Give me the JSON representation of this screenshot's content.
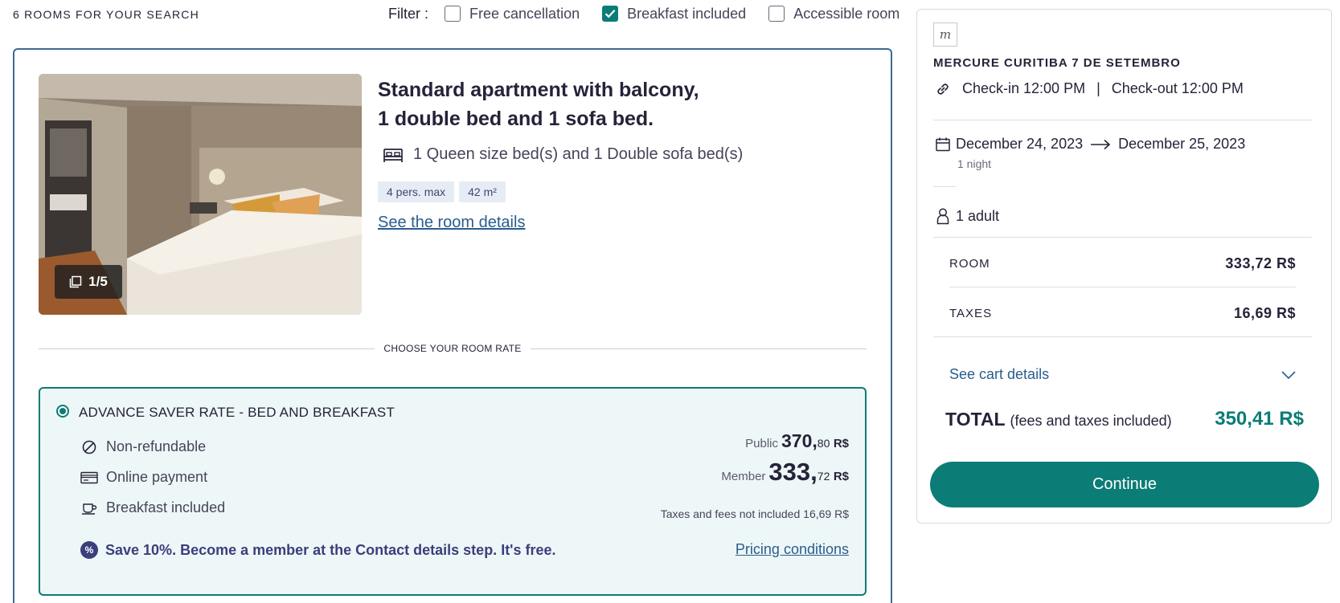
{
  "results": {
    "count_label": "6 ROOMS FOR YOUR SEARCH"
  },
  "filters": {
    "label": "Filter :",
    "options": [
      {
        "label": "Free cancellation",
        "checked": false
      },
      {
        "label": "Breakfast included",
        "checked": true
      },
      {
        "label": "Accessible room",
        "checked": false
      }
    ]
  },
  "room": {
    "title_line1": "Standard apartment with balcony,",
    "title_line2": "1 double bed and 1 sofa bed.",
    "beds": "1 Queen size bed(s) and 1 Double sofa bed(s)",
    "tags": [
      "4 pers. max",
      "42 m²"
    ],
    "details_link": "See the room details",
    "gallery_counter": "1/5",
    "choose_rate_label": "CHOOSE YOUR ROOM RATE"
  },
  "rate": {
    "name": "ADVANCE SAVER RATE - BED AND BREAKFAST",
    "selected": true,
    "features": [
      "Non-refundable",
      "Online payment",
      "Breakfast included"
    ],
    "promo": "Save 10%. Become a member at the Contact details step. It's free.",
    "public_label": "Public",
    "public_int": "370",
    "public_cents": "80",
    "member_label": "Member",
    "member_int": "333",
    "member_cents": "72",
    "separator": ",",
    "currency": "R$",
    "taxes_note_prefix": "Taxes and fees not included",
    "taxes_int": "16",
    "taxes_cents": "69",
    "pricing_link": "Pricing conditions"
  },
  "summary": {
    "hotel_logo_glyph": "m",
    "hotel_name": "MERCURE CURITIBA 7 DE SETEMBRO",
    "checkin": "Check-in 12:00 PM",
    "separator": "|",
    "checkout": "Check-out 12:00 PM",
    "date_from": "December 24, 2023",
    "date_to": "December 25, 2023",
    "nights": "1 night",
    "guests": "1 adult",
    "room_label": "ROOM",
    "room_price": "333,72 R$",
    "taxes_label": "TAXES",
    "taxes_price": "16,69 R$",
    "cart_details": "See cart details",
    "total_label": "TOTAL",
    "total_note": "(fees and taxes included)",
    "total_price": "350,41 R$",
    "continue_label": "Continue"
  },
  "colors": {
    "accent": "#0b7c76",
    "navy": "#3d6a92",
    "link": "#2a5d8d",
    "promo": "#3c3e7c",
    "text": "#252339"
  }
}
